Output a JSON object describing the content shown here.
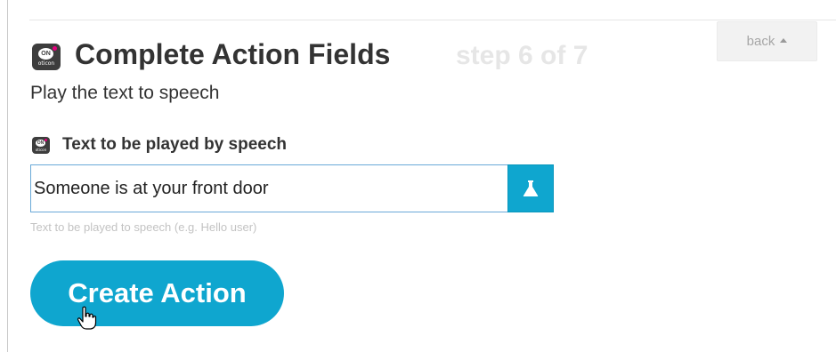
{
  "header": {
    "app_icon": {
      "badge_text": "ON",
      "brand_text": "oticon",
      "background_color": "#3d3d3d",
      "dot_color": "#e4007d"
    },
    "title": "Complete Action Fields",
    "step_text": "step 6 of 7",
    "back_label": "back",
    "back_icon": "caret-up-icon"
  },
  "action": {
    "subtitle": "Play the text to speech",
    "field": {
      "label": "Text to be played by speech",
      "value": "Someone is at your front door",
      "helper_text": "Text to be played to speech (e.g. Hello user)",
      "test_icon": "flask-icon"
    },
    "submit_label": "Create Action"
  },
  "colors": {
    "accent": "#0fa6cf",
    "title_text": "#333333",
    "step_text": "#e6e6e6",
    "helper_text": "#c3c3c3"
  },
  "cursor": {
    "icon": "hand-pointer-icon"
  }
}
